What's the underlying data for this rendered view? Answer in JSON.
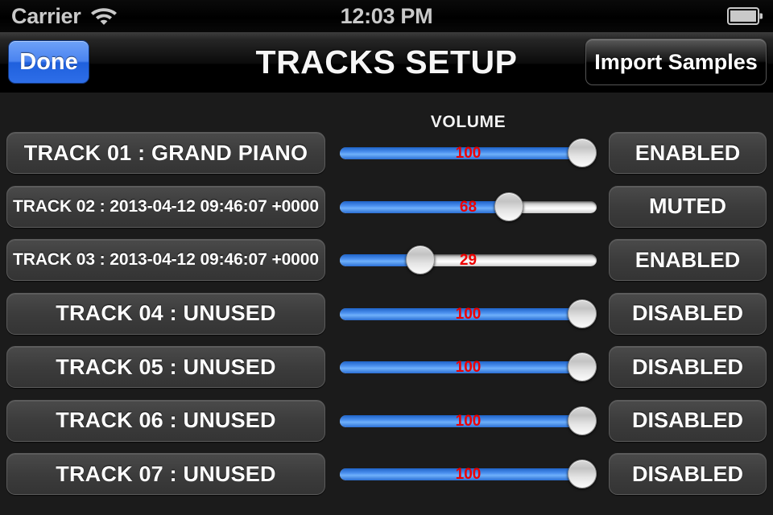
{
  "status_bar": {
    "carrier": "Carrier",
    "wifi_icon": "wifi-icon",
    "time": "12:03 PM",
    "battery_icon": "battery-full-icon"
  },
  "nav_bar": {
    "done_label": "Done",
    "title": "TRACKS SETUP",
    "import_label": "Import Samples"
  },
  "content": {
    "volume_header": "VOLUME",
    "slider_min": 0,
    "slider_max": 100,
    "value_color": "#ee0000",
    "fill_color": "#4d92f0",
    "tracks": [
      {
        "name": "TRACK 01 : GRAND PIANO",
        "name_size": "big",
        "volume": 100,
        "status": "ENABLED"
      },
      {
        "name": "TRACK 02 : 2013-04-12 09:46:07 +0000",
        "name_size": "small",
        "volume": 68,
        "status": "MUTED"
      },
      {
        "name": "TRACK 03 : 2013-04-12 09:46:07 +0000",
        "name_size": "small",
        "volume": 29,
        "status": "ENABLED"
      },
      {
        "name": "TRACK 04 : UNUSED",
        "name_size": "big",
        "volume": 100,
        "status": "DISABLED"
      },
      {
        "name": "TRACK 05 : UNUSED",
        "name_size": "big",
        "volume": 100,
        "status": "DISABLED"
      },
      {
        "name": "TRACK 06 : UNUSED",
        "name_size": "big",
        "volume": 100,
        "status": "DISABLED"
      },
      {
        "name": "TRACK 07 : UNUSED",
        "name_size": "big",
        "volume": 100,
        "status": "DISABLED"
      }
    ]
  }
}
